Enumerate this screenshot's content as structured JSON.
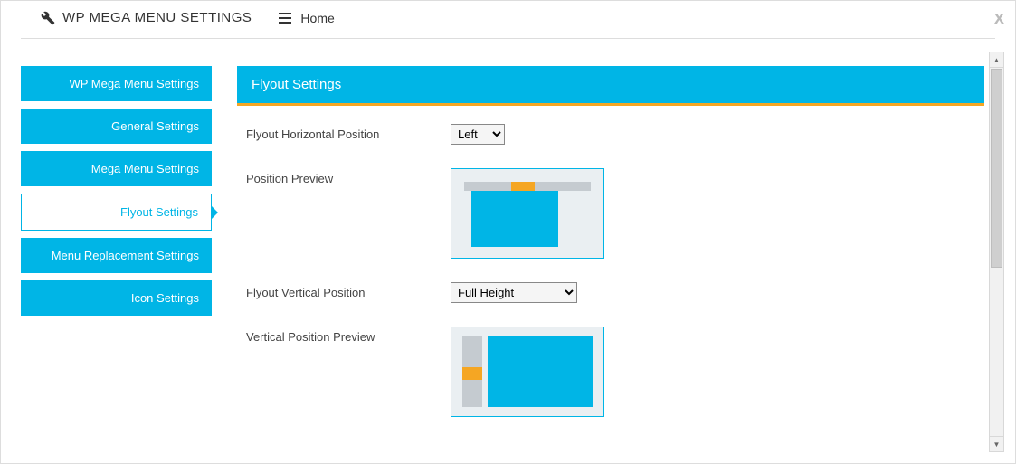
{
  "header": {
    "title": "WP MEGA MENU SETTINGS",
    "home_label": "Home"
  },
  "sidebar": {
    "items": [
      {
        "label": "WP Mega Menu Settings"
      },
      {
        "label": "General Settings"
      },
      {
        "label": "Mega Menu Settings"
      },
      {
        "label": "Flyout Settings"
      },
      {
        "label": "Menu Replacement Settings"
      },
      {
        "label": "Icon Settings"
      }
    ],
    "active_index": 3
  },
  "panel": {
    "title": "Flyout Settings",
    "rows": {
      "horizontal_label": "Flyout Horizontal Position",
      "horizontal_value": "Left",
      "horizontal_preview_label": "Position Preview",
      "vertical_label": "Flyout Vertical Position",
      "vertical_value": "Full Height",
      "vertical_preview_label": "Vertical Position Preview"
    }
  },
  "colors": {
    "primary": "#00b5e6",
    "accent": "#f5a623"
  }
}
